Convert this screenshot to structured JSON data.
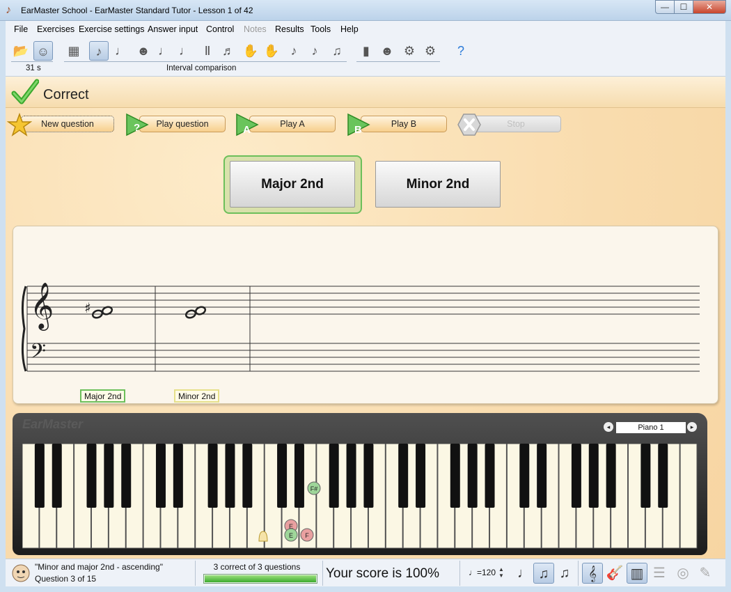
{
  "window": {
    "title": "EarMaster School - EarMaster Standard Tutor - Lesson 1 of 42",
    "minimize": "—",
    "maximize": "☐",
    "close": "✕"
  },
  "menu": {
    "items": [
      "File",
      "Exercises",
      "Exercise settings",
      "Answer input",
      "Control",
      "Notes",
      "Results",
      "Tools",
      "Help"
    ],
    "disabled": [
      "Notes"
    ]
  },
  "toolbar": {
    "timer": "31 s",
    "exercise_name": "Interval comparison",
    "icons": [
      "open-folder-icon",
      "tutor-face-icon",
      "fretboard-icon",
      "interval-comparison-icon",
      "interval-icon",
      "chord-comparison-icon",
      "chord-icon",
      "chord-inversion-icon",
      "progression-icon",
      "scale-icon",
      "rhythm-clap-icon",
      "rhythm-tap-icon",
      "rhythm-imitation-icon",
      "rhythm-dictation-icon",
      "melody-icon",
      "statistics-icon",
      "user-icon",
      "settings-icon",
      "tools-icon",
      "help-icon"
    ]
  },
  "status": {
    "text": "Correct",
    "icon": "checkmark-icon"
  },
  "actions": {
    "new_question": "New question",
    "play_question": "Play question",
    "play_a": "Play A",
    "play_b": "Play B",
    "stop": "Stop"
  },
  "answers": {
    "a": "Major 2nd",
    "b": "Minor 2nd",
    "selected": "a"
  },
  "staff": {
    "labels": [
      "Major 2nd",
      "Minor 2nd"
    ],
    "label_colors": [
      "#6cbf5a",
      "#e6e08a"
    ],
    "accidental": "♯"
  },
  "piano": {
    "brand": "EarMaster",
    "instrument": "Piano 1",
    "prev": "◂",
    "next": "▸",
    "markers": [
      "E",
      "E",
      "F",
      "F#"
    ]
  },
  "statusbar": {
    "lesson": "\"Minor and major 2nd - ascending\"",
    "question": "Question 3 of 15",
    "correct": "3 correct of 3 questions",
    "progress": 1.0,
    "score": "Your score is 100%",
    "tempo_note": "♩=",
    "tempo": "120"
  },
  "colors": {
    "accent_green": "#6cbf5a",
    "button_orange": "#f7cf8c",
    "panel_bg": "#fbe4bd"
  }
}
